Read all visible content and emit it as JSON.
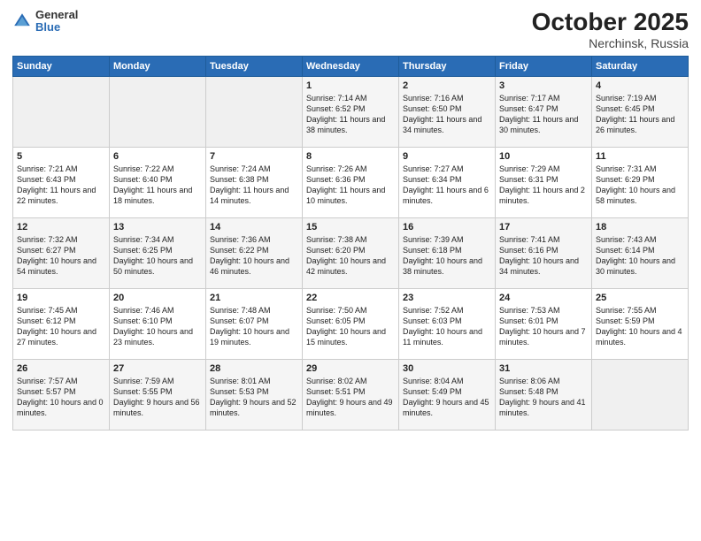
{
  "header": {
    "logo_general": "General",
    "logo_blue": "Blue",
    "month": "October 2025",
    "location": "Nerchinsk, Russia"
  },
  "weekdays": [
    "Sunday",
    "Monday",
    "Tuesday",
    "Wednesday",
    "Thursday",
    "Friday",
    "Saturday"
  ],
  "weeks": [
    [
      {
        "day": "",
        "text": ""
      },
      {
        "day": "",
        "text": ""
      },
      {
        "day": "",
        "text": ""
      },
      {
        "day": "1",
        "text": "Sunrise: 7:14 AM\nSunset: 6:52 PM\nDaylight: 11 hours and 38 minutes."
      },
      {
        "day": "2",
        "text": "Sunrise: 7:16 AM\nSunset: 6:50 PM\nDaylight: 11 hours and 34 minutes."
      },
      {
        "day": "3",
        "text": "Sunrise: 7:17 AM\nSunset: 6:47 PM\nDaylight: 11 hours and 30 minutes."
      },
      {
        "day": "4",
        "text": "Sunrise: 7:19 AM\nSunset: 6:45 PM\nDaylight: 11 hours and 26 minutes."
      }
    ],
    [
      {
        "day": "5",
        "text": "Sunrise: 7:21 AM\nSunset: 6:43 PM\nDaylight: 11 hours and 22 minutes."
      },
      {
        "day": "6",
        "text": "Sunrise: 7:22 AM\nSunset: 6:40 PM\nDaylight: 11 hours and 18 minutes."
      },
      {
        "day": "7",
        "text": "Sunrise: 7:24 AM\nSunset: 6:38 PM\nDaylight: 11 hours and 14 minutes."
      },
      {
        "day": "8",
        "text": "Sunrise: 7:26 AM\nSunset: 6:36 PM\nDaylight: 11 hours and 10 minutes."
      },
      {
        "day": "9",
        "text": "Sunrise: 7:27 AM\nSunset: 6:34 PM\nDaylight: 11 hours and 6 minutes."
      },
      {
        "day": "10",
        "text": "Sunrise: 7:29 AM\nSunset: 6:31 PM\nDaylight: 11 hours and 2 minutes."
      },
      {
        "day": "11",
        "text": "Sunrise: 7:31 AM\nSunset: 6:29 PM\nDaylight: 10 hours and 58 minutes."
      }
    ],
    [
      {
        "day": "12",
        "text": "Sunrise: 7:32 AM\nSunset: 6:27 PM\nDaylight: 10 hours and 54 minutes."
      },
      {
        "day": "13",
        "text": "Sunrise: 7:34 AM\nSunset: 6:25 PM\nDaylight: 10 hours and 50 minutes."
      },
      {
        "day": "14",
        "text": "Sunrise: 7:36 AM\nSunset: 6:22 PM\nDaylight: 10 hours and 46 minutes."
      },
      {
        "day": "15",
        "text": "Sunrise: 7:38 AM\nSunset: 6:20 PM\nDaylight: 10 hours and 42 minutes."
      },
      {
        "day": "16",
        "text": "Sunrise: 7:39 AM\nSunset: 6:18 PM\nDaylight: 10 hours and 38 minutes."
      },
      {
        "day": "17",
        "text": "Sunrise: 7:41 AM\nSunset: 6:16 PM\nDaylight: 10 hours and 34 minutes."
      },
      {
        "day": "18",
        "text": "Sunrise: 7:43 AM\nSunset: 6:14 PM\nDaylight: 10 hours and 30 minutes."
      }
    ],
    [
      {
        "day": "19",
        "text": "Sunrise: 7:45 AM\nSunset: 6:12 PM\nDaylight: 10 hours and 27 minutes."
      },
      {
        "day": "20",
        "text": "Sunrise: 7:46 AM\nSunset: 6:10 PM\nDaylight: 10 hours and 23 minutes."
      },
      {
        "day": "21",
        "text": "Sunrise: 7:48 AM\nSunset: 6:07 PM\nDaylight: 10 hours and 19 minutes."
      },
      {
        "day": "22",
        "text": "Sunrise: 7:50 AM\nSunset: 6:05 PM\nDaylight: 10 hours and 15 minutes."
      },
      {
        "day": "23",
        "text": "Sunrise: 7:52 AM\nSunset: 6:03 PM\nDaylight: 10 hours and 11 minutes."
      },
      {
        "day": "24",
        "text": "Sunrise: 7:53 AM\nSunset: 6:01 PM\nDaylight: 10 hours and 7 minutes."
      },
      {
        "day": "25",
        "text": "Sunrise: 7:55 AM\nSunset: 5:59 PM\nDaylight: 10 hours and 4 minutes."
      }
    ],
    [
      {
        "day": "26",
        "text": "Sunrise: 7:57 AM\nSunset: 5:57 PM\nDaylight: 10 hours and 0 minutes."
      },
      {
        "day": "27",
        "text": "Sunrise: 7:59 AM\nSunset: 5:55 PM\nDaylight: 9 hours and 56 minutes."
      },
      {
        "day": "28",
        "text": "Sunrise: 8:01 AM\nSunset: 5:53 PM\nDaylight: 9 hours and 52 minutes."
      },
      {
        "day": "29",
        "text": "Sunrise: 8:02 AM\nSunset: 5:51 PM\nDaylight: 9 hours and 49 minutes."
      },
      {
        "day": "30",
        "text": "Sunrise: 8:04 AM\nSunset: 5:49 PM\nDaylight: 9 hours and 45 minutes."
      },
      {
        "day": "31",
        "text": "Sunrise: 8:06 AM\nSunset: 5:48 PM\nDaylight: 9 hours and 41 minutes."
      },
      {
        "day": "",
        "text": ""
      }
    ]
  ]
}
